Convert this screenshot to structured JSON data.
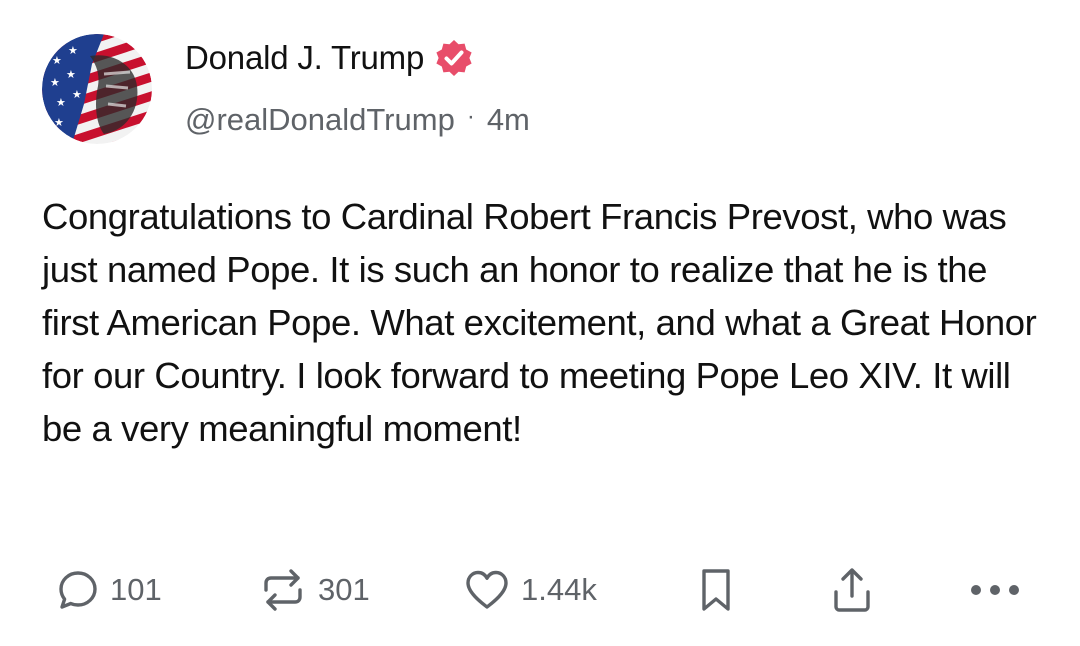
{
  "post": {
    "author": {
      "display_name": "Donald J. Trump",
      "handle": "@realDonaldTrump",
      "verified": true,
      "verified_color": "#e84d6a"
    },
    "separator": "·",
    "time": "4m",
    "text": "Congratulations to Cardinal Robert Francis Prevost, who was just named Pope. It is such an honor to realize that he is the first American Pope. What excitement, and what a Great Honor for our Country. I look forward to meeting Pope Leo XIV. It will be a very meaningful moment!",
    "actions": {
      "reply": {
        "icon": "reply-icon",
        "count": "101"
      },
      "repost": {
        "icon": "repost-icon",
        "count": "301"
      },
      "like": {
        "icon": "heart-icon",
        "count": "1.44k"
      },
      "bookmark": {
        "icon": "bookmark-icon"
      },
      "share": {
        "icon": "share-icon"
      },
      "more": {
        "icon": "more-icon"
      }
    },
    "icon_color": "#5f6368"
  }
}
